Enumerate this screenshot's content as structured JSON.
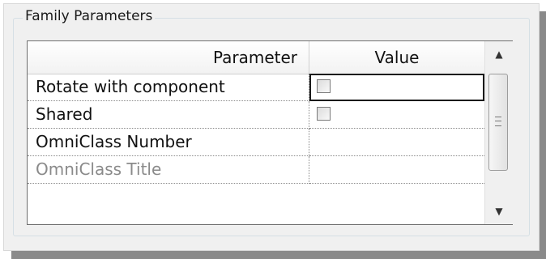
{
  "group_title": "Family Parameters",
  "columns": {
    "parameter": "Parameter",
    "value": "Value"
  },
  "rows": [
    {
      "parameter": "Rotate with component",
      "value_type": "checkbox",
      "checked": false,
      "selected": true
    },
    {
      "parameter": "Shared",
      "value_type": "checkbox",
      "checked": false,
      "selected": false
    },
    {
      "parameter": "OmniClass Number",
      "value_type": "empty",
      "selected": false
    },
    {
      "parameter": "OmniClass Title",
      "value_type": "empty",
      "selected": false,
      "disabled": true
    }
  ],
  "scrollbar": {
    "up_icon": "▲",
    "down_icon": "▼"
  }
}
